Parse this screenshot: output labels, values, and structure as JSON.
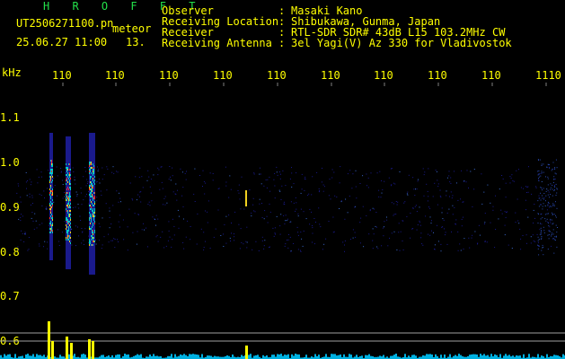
{
  "brand": "H R O F F T",
  "file_name": "UT2506271100.pn",
  "file_type": "meteor",
  "datetime": "25.06.27 11:00",
  "seconds_label": "13.",
  "info": [
    {
      "label": "Observer",
      "sep": ":",
      "value": "Masaki Kano"
    },
    {
      "label": "Receiving Location",
      "sep": ":",
      "value": "Shibukawa, Gunma, Japan"
    },
    {
      "label": "Receiver",
      "sep": ":",
      "value": "RTL-SDR SDR# 43dB L15 103.2MHz CW"
    },
    {
      "label": "Receiving Antenna",
      "sep": ":",
      "value": "3el Yagi(V) Az 330 for Vladivostok"
    }
  ],
  "x_ticks": [
    "110",
    "110",
    "110",
    "110",
    "110",
    "110",
    "110",
    "110",
    "110",
    "1110"
  ],
  "y_unit": "kHz",
  "y_ticks": [
    "1.1",
    "1.0",
    "0.9",
    "0.8",
    "0.7",
    "0.6"
  ],
  "colors": {
    "background": "#000000",
    "text": "#ffff00",
    "brand": "#23e04a",
    "spectrum_low": "#1a1a8c",
    "spectrum_mid": "#00c8c8",
    "spectrum_high": "#ff3030",
    "baseline": "#00b0e0",
    "peak": "#ffff00",
    "guide_line": "#a0a0a0"
  }
}
